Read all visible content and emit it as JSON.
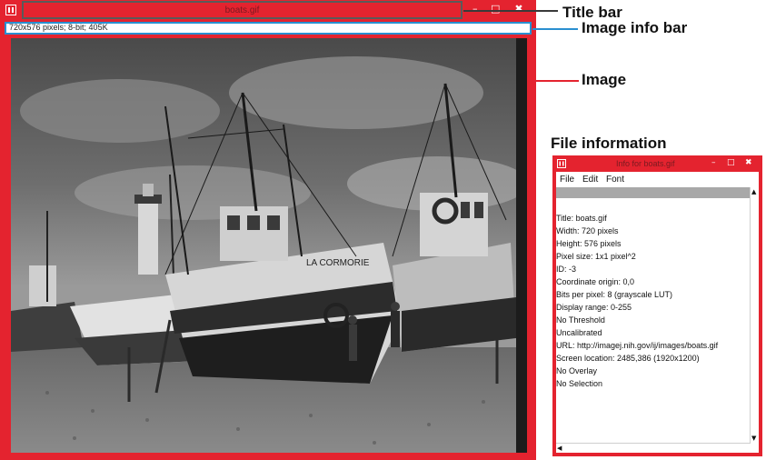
{
  "main_window": {
    "title": "boats.gif",
    "minimize_glyph": "–",
    "maximize_glyph": "□",
    "close_glyph": "✖",
    "image_info": "720x576 pixels; 8-bit; 405K"
  },
  "annotations": {
    "title_bar": "Title bar",
    "image_info_bar": "Image info bar",
    "image": "Image",
    "file_information": "File information"
  },
  "info_window": {
    "title": "Info for boats.gif",
    "menu": [
      "File",
      "Edit",
      "Font"
    ],
    "lines": [
      "Title: boats.gif",
      "Width:  720 pixels",
      "Height:  576 pixels",
      "Pixel size: 1x1 pixel^2",
      "ID: -3",
      "Coordinate origin:  0,0",
      "Bits per pixel: 8 (grayscale LUT)",
      "Display range: 0-255",
      "No Threshold",
      "Uncalibrated",
      "URL: http://imagej.nih.gov/ij/images/boats.gif",
      "Screen location: 2485,386 (1920x1200)",
      "No Overlay",
      "No Selection"
    ]
  },
  "colors": {
    "window_highlight": "#e4232f",
    "info_bar_border": "#2a8fd0",
    "title_bar_highlight": "#5a5a5a"
  }
}
